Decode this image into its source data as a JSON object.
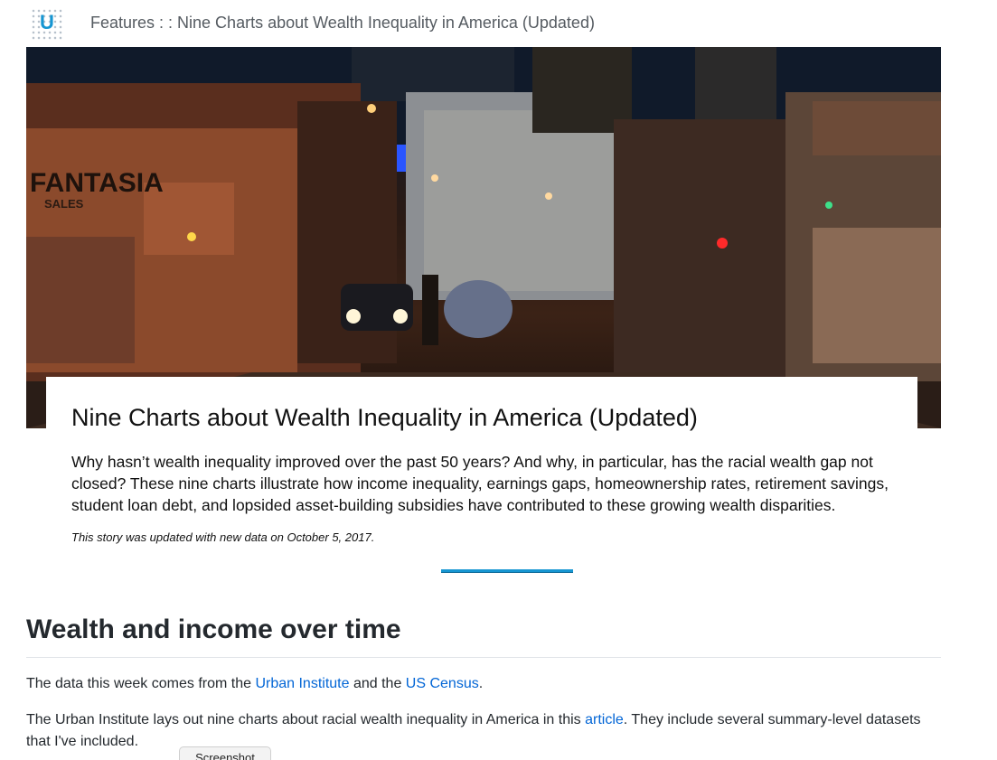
{
  "header": {
    "logo_letter": "U",
    "title": "Features : : Nine Charts about Wealth Inequality in America (Updated)"
  },
  "hero": {
    "sign_store": "FANTASIA",
    "sign_sales": "SALES"
  },
  "card": {
    "title": "Nine Charts about Wealth Inequality in America (Updated)",
    "body": "Why hasn’t wealth inequality improved over the past 50 years? And why, in particular, has the racial wealth gap not closed? These nine charts illustrate how income inequality, earnings gaps, homeownership rates, retirement savings, student loan debt, and lopsided asset-building subsidies have contributed to these growing wealth disparities.",
    "note": "This story was updated with new data on October 5, 2017."
  },
  "section": {
    "heading": "Wealth and income over time",
    "p1_before": "The data this week comes from the ",
    "p1_link1": "Urban Institute",
    "p1_mid": " and the ",
    "p1_link2": "US Census",
    "p1_after": ".",
    "p2_before": "The Urban Institute lays out nine charts about racial wealth inequality in America in this ",
    "p2_link": "article",
    "p2_after": ". They include several summary-level datasets that I've included."
  },
  "footer": {
    "button_label": "Screenshot"
  }
}
